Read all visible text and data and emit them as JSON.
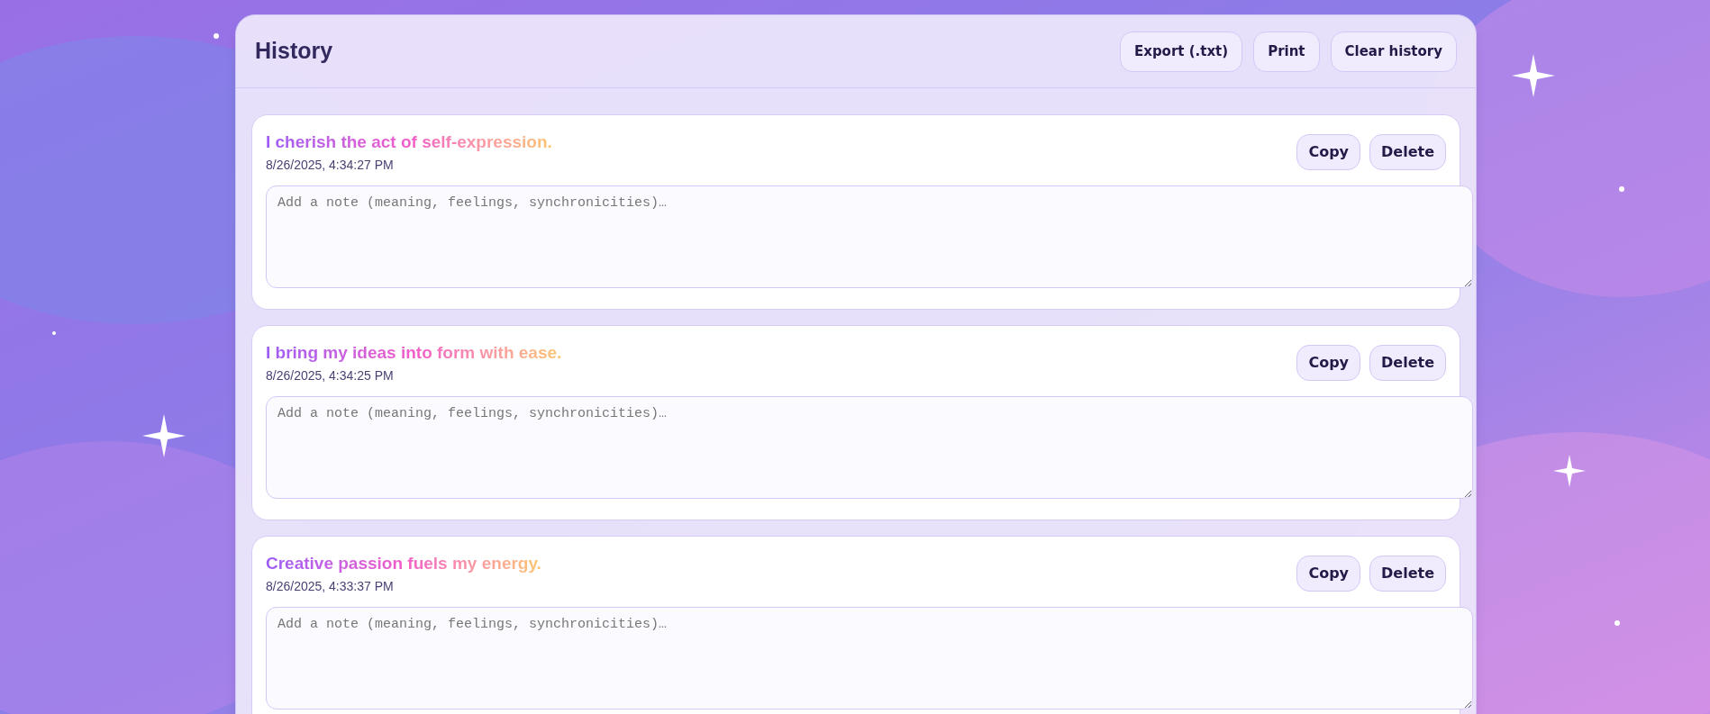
{
  "header": {
    "title": "History",
    "buttons": [
      "Export (.txt)",
      "Print",
      "Clear history"
    ]
  },
  "entries": [
    {
      "affirmation": "I cherish the act of self-expression.",
      "timestamp": "8/26/2025, 4:34:27 PM",
      "note_placeholder": "Add a note (meaning, feelings, synchronicities)…",
      "buttons": [
        "Copy",
        "Delete"
      ]
    },
    {
      "affirmation": "I bring my ideas into form with ease.",
      "timestamp": "8/26/2025, 4:34:25 PM",
      "note_placeholder": "Add a note (meaning, feelings, synchronicities)…",
      "buttons": [
        "Copy",
        "Delete"
      ]
    },
    {
      "affirmation": "Creative passion fuels my energy.",
      "timestamp": "8/26/2025, 4:33:37 PM",
      "note_placeholder": "Add a note (meaning, feelings, synchronicities)…",
      "buttons": [
        "Copy",
        "Delete"
      ]
    }
  ]
}
